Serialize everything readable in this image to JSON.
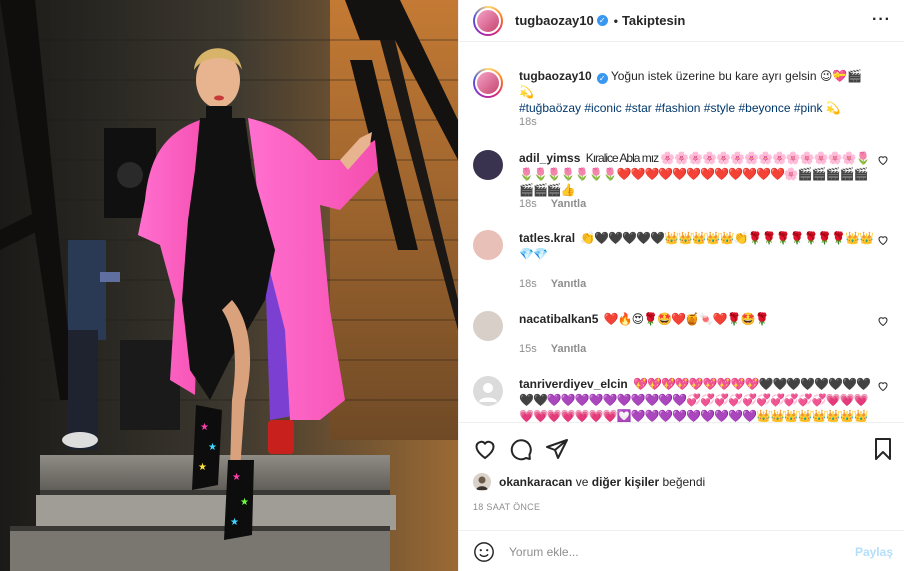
{
  "header": {
    "username": "tugbaozay10",
    "verified": true,
    "separator": "•",
    "follow_status": "Takiptesin",
    "more_icon": "more-horizontal-icon"
  },
  "caption": {
    "username": "tugbaozay10",
    "text": "Yoğun istek üzerine bu kare ayrı gelsin 😉💝🎬💫",
    "hashtags": "#tuğbaözay #iconic #star #fashion #style #beyonce #pink 💫",
    "time": "18s"
  },
  "comments": [
    {
      "username": "adil_yimss",
      "text": "Kıralice Abla mız 🌸🌸🌸🌸🌸🌸🌸🌸🌸🌸🌸🌸🌸🌸🌷🌷🌷🌷🌷🌷🌷🌷❤️❤️❤️❤️❤️❤️❤️❤️❤️❤️❤️❤️🌸🎬🎬🎬🎬🎬🎬🎬🎬👍",
      "time": "18s",
      "reply": "Yanıtla"
    },
    {
      "username": "tatles.kral",
      "text": "👏🖤🖤🖤🖤🖤👑👑👑👑👑👏🌹🌹🌹🌹🌹🌹🌹👑👑💎💎",
      "time": "18s",
      "reply": "Yanıtla"
    },
    {
      "username": "nacatibalkan5",
      "text": "❤️🔥😍🌹🤩❤️🍯🍬❤️🌹🤩🌹",
      "time": "15s",
      "reply": "Yanıtla"
    },
    {
      "username": "tanriverdiyev_elcin",
      "text": "💖💖💖💖💖💖💖💖💖🖤🖤🖤🖤🖤🖤🖤🖤🖤🖤💜💜💜💜💜💜💜💜💜💜💞💞💞💞💞💞💞💞💞💞💗💗💗💗💗💗💗💗💗💗💟💜💜💜💜💜💜💜💜💜👑👑👑👑👑👑👑👑👑👑👑👑👑👑👑👑",
      "time": "",
      "reply": ""
    }
  ],
  "actions": {
    "like_icon": "heart-icon",
    "comment_icon": "comment-icon",
    "share_icon": "paper-plane-icon",
    "save_icon": "bookmark-icon"
  },
  "likes": {
    "first_user": "okankaracan",
    "connector": "ve",
    "others": "diğer kişiler",
    "suffix": "beğendi"
  },
  "timestamp": "18 SAAT ÖNCE",
  "add_comment": {
    "placeholder": "Yorum ekle...",
    "post_label": "Paylaş",
    "emoji_icon": "smiley-icon"
  },
  "colors": {
    "link": "#00376b",
    "muted": "#8e8e8e",
    "verified": "#3897f0",
    "post_disabled": "#b2dffc",
    "coat_pink": "#f55bb8"
  }
}
